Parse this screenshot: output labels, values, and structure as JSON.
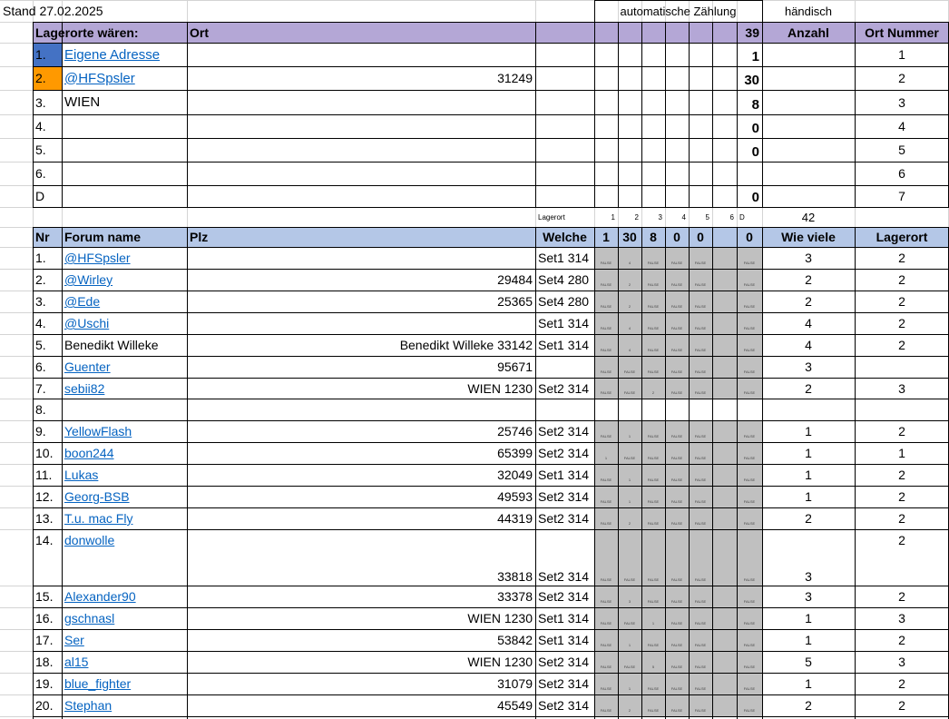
{
  "stand": "Stand 27.02.2025",
  "auto_label": "automatische Zählung",
  "haendisch_label": "händisch",
  "top_header": {
    "lagerorte": "Lagerorte wären:",
    "ort": "Ort",
    "total": "39",
    "anzahl": "Anzahl",
    "ort_nummer": "Ort Nummer"
  },
  "lagerorte": [
    {
      "n": "1.",
      "name": "Eigene Adresse",
      "ort": "",
      "count": "1",
      "ortnr": "1"
    },
    {
      "n": "2.",
      "name": "@HFSpsler",
      "ort": "31249",
      "count": "30",
      "ortnr": "2"
    },
    {
      "n": "3.",
      "name": "WIEN",
      "ort": "",
      "count": "8",
      "ortnr": "3"
    },
    {
      "n": "4.",
      "name": "",
      "ort": "",
      "count": "0",
      "ortnr": "4"
    },
    {
      "n": "5.",
      "name": "",
      "ort": "",
      "count": "0",
      "ortnr": "5"
    },
    {
      "n": "6.",
      "name": "",
      "ort": "",
      "count": "",
      "ortnr": "6"
    },
    {
      "n": "D",
      "name": "",
      "ort": "",
      "count": "0",
      "ortnr": "7"
    }
  ],
  "mini": {
    "lagerort": "Lagerort",
    "nums": [
      "1",
      "2",
      "3",
      "4",
      "5",
      "6",
      "D"
    ],
    "total": "42"
  },
  "header": {
    "nr": "Nr",
    "forum": "Forum name",
    "plz": "Plz",
    "welche": "Welche",
    "counts": [
      "1",
      "30",
      "8",
      "0",
      "0",
      "",
      "0"
    ],
    "wie_viele": "Wie viele",
    "lagerort": "Lagerort"
  },
  "rows": [
    {
      "nr": "1.",
      "name": "@HFSpsler",
      "plz": "",
      "welche": "Set1 314",
      "tiny": [
        "FALSE",
        "4",
        "FALSE",
        "FALSE",
        "FALSE",
        "",
        "FALSE"
      ],
      "wie": "3",
      "lag": "2",
      "link": true
    },
    {
      "nr": "2.",
      "name": "@Wirley",
      "plz": "29484",
      "welche": "Set4 280",
      "tiny": [
        "FALSE",
        "2",
        "FALSE",
        "FALSE",
        "FALSE",
        "",
        "FALSE"
      ],
      "wie": "2",
      "lag": "2",
      "link": true
    },
    {
      "nr": "3.",
      "name": "@Ede",
      "plz": "25365",
      "welche": "Set4 280",
      "tiny": [
        "FALSE",
        "2",
        "FALSE",
        "FALSE",
        "FALSE",
        "",
        "FALSE"
      ],
      "wie": "2",
      "lag": "2",
      "link": true
    },
    {
      "nr": "4.",
      "name": "@Uschi",
      "plz": "",
      "welche": "Set1 314",
      "tiny": [
        "FALSE",
        "4",
        "FALSE",
        "FALSE",
        "FALSE",
        "",
        "FALSE"
      ],
      "wie": "4",
      "lag": "2",
      "link": true
    },
    {
      "nr": "5.",
      "name": "Benedikt Willeke",
      "plz": "Benedikt Willeke 33142",
      "welche": "Set1 314",
      "tiny": [
        "FALSE",
        "4",
        "FALSE",
        "FALSE",
        "FALSE",
        "",
        "FALSE"
      ],
      "wie": "4",
      "lag": "2",
      "link": false
    },
    {
      "nr": "6.",
      "name": "Guenter",
      "plz": "95671",
      "welche": "",
      "tiny": [
        "FALSE",
        "FALSE",
        "FALSE",
        "FALSE",
        "FALSE",
        "",
        "FALSE"
      ],
      "wie": "3",
      "lag": "",
      "link": true
    },
    {
      "nr": "7.",
      "name": "sebii82",
      "plz": "WIEN 1230",
      "welche": "Set2 314",
      "tiny": [
        "FALSE",
        "FALSE",
        "2",
        "FALSE",
        "FALSE",
        "",
        "FALSE"
      ],
      "wie": "2",
      "lag": "3",
      "link": true
    },
    {
      "nr": "8.",
      "name": "",
      "plz": "",
      "welche": "",
      "tiny": [
        "",
        "",
        "",
        "",
        "",
        "",
        ""
      ],
      "wie": "",
      "lag": "",
      "link": false
    },
    {
      "nr": "9.",
      "name": "YellowFlash",
      "plz": "25746",
      "welche": "Set2 314",
      "tiny": [
        "FALSE",
        "1",
        "FALSE",
        "FALSE",
        "FALSE",
        "",
        "FALSE"
      ],
      "wie": "1",
      "lag": "2",
      "link": true
    },
    {
      "nr": "10.",
      "name": "boon244",
      "plz": "65399",
      "welche": "Set2 314",
      "tiny": [
        "1",
        "FALSE",
        "FALSE",
        "FALSE",
        "FALSE",
        "",
        "FALSE"
      ],
      "wie": "1",
      "lag": "1",
      "link": true
    },
    {
      "nr": "11.",
      "name": "Lukas",
      "plz": "32049",
      "welche": "Set1 314",
      "tiny": [
        "FALSE",
        "1",
        "FALSE",
        "FALSE",
        "FALSE",
        "",
        "FALSE"
      ],
      "wie": "1",
      "lag": "2",
      "link": true
    },
    {
      "nr": "12.",
      "name": "Georg-BSB",
      "plz": "49593",
      "welche": "Set2 314",
      "tiny": [
        "FALSE",
        "1",
        "FALSE",
        "FALSE",
        "FALSE",
        "",
        "FALSE"
      ],
      "wie": "1",
      "lag": "2",
      "link": true
    },
    {
      "nr": "13.",
      "name": "T.u. mac Fly",
      "plz": "44319",
      "welche": "Set2 314",
      "tiny": [
        "FALSE",
        "2",
        "FALSE",
        "FALSE",
        "FALSE",
        "",
        "FALSE"
      ],
      "wie": "2",
      "lag": "2",
      "link": true
    },
    {
      "nr": "14.",
      "name": "donwolle",
      "plz": "33818",
      "welche": "Set2 314",
      "tiny": [
        "FALSE",
        "FALSE",
        "FALSE",
        "FALSE",
        "FALSE",
        "",
        "FALSE"
      ],
      "wie": "3",
      "lag": "2",
      "link": true,
      "tall": true
    },
    {
      "nr": "15.",
      "name": "Alexander90",
      "plz": "33378",
      "welche": "Set2 314",
      "tiny": [
        "FALSE",
        "3",
        "FALSE",
        "FALSE",
        "FALSE",
        "",
        "FALSE"
      ],
      "wie": "3",
      "lag": "2",
      "link": true
    },
    {
      "nr": "16.",
      "name": "gschnasl",
      "plz": "WIEN 1230",
      "welche": "Set1 314",
      "tiny": [
        "FALSE",
        "FALSE",
        "1",
        "FALSE",
        "FALSE",
        "",
        "FALSE"
      ],
      "wie": "1",
      "lag": "3",
      "link": true
    },
    {
      "nr": "17.",
      "name": "Ser",
      "plz": "53842",
      "welche": "Set1 314",
      "tiny": [
        "FALSE",
        "1",
        "FALSE",
        "FALSE",
        "FALSE",
        "",
        "FALSE"
      ],
      "wie": "1",
      "lag": "2",
      "link": true
    },
    {
      "nr": "18.",
      "name": "al15",
      "plz": "WIEN 1230",
      "welche": "Set2 314",
      "tiny": [
        "FALSE",
        "FALSE",
        "5",
        "FALSE",
        "FALSE",
        "",
        "FALSE"
      ],
      "wie": "5",
      "lag": "3",
      "link": true
    },
    {
      "nr": "19.",
      "name": "blue_fighter",
      "plz": "31079",
      "welche": "Set2 314",
      "tiny": [
        "FALSE",
        "1",
        "FALSE",
        "FALSE",
        "FALSE",
        "",
        "FALSE"
      ],
      "wie": "1",
      "lag": "2",
      "link": true
    },
    {
      "nr": "20.",
      "name": "Stephan",
      "plz": "45549",
      "welche": "Set2 314",
      "tiny": [
        "FALSE",
        "2",
        "FALSE",
        "FALSE",
        "FALSE",
        "",
        "FALSE"
      ],
      "wie": "2",
      "lag": "2",
      "link": true
    }
  ],
  "colors": {
    "header_purple": "#b4a7d6",
    "header_blue": "#b4c7e7",
    "loc1": "#4472c4",
    "loc2": "#ff9900",
    "grey": "#c0c0c0",
    "link": "#0563c1"
  }
}
